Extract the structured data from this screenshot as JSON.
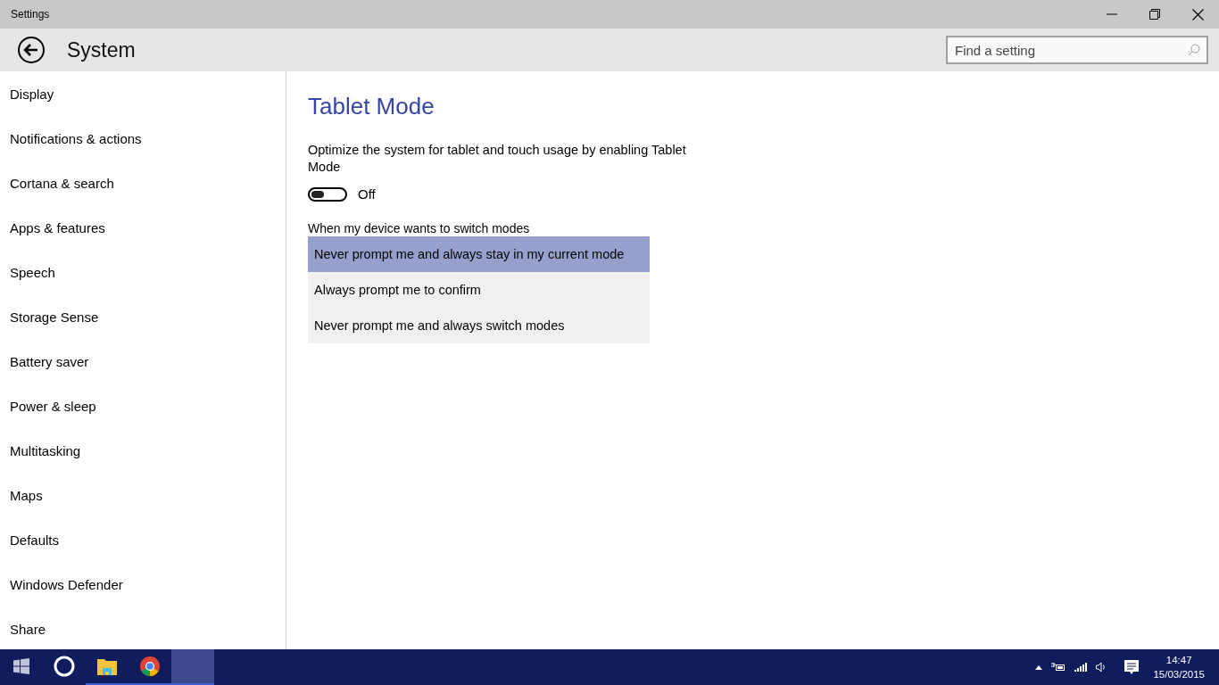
{
  "window": {
    "title": "Settings"
  },
  "header": {
    "title": "System",
    "search": {
      "placeholder": "Find a setting"
    }
  },
  "sidebar": {
    "items": [
      {
        "label": "Display",
        "selected": false
      },
      {
        "label": "Notifications & actions",
        "selected": false
      },
      {
        "label": "Cortana & search",
        "selected": false
      },
      {
        "label": "Apps & features",
        "selected": false
      },
      {
        "label": "Speech",
        "selected": false
      },
      {
        "label": "Storage Sense",
        "selected": false
      },
      {
        "label": "Battery saver",
        "selected": false
      },
      {
        "label": "Power & sleep",
        "selected": false
      },
      {
        "label": "Multitasking",
        "selected": false
      },
      {
        "label": "Maps",
        "selected": false
      },
      {
        "label": "Defaults",
        "selected": false
      },
      {
        "label": "Windows Defender",
        "selected": false
      },
      {
        "label": "Share",
        "selected": false
      }
    ]
  },
  "content": {
    "title": "Tablet Mode",
    "description": "Optimize the system for tablet and touch usage by enabling Tablet Mode",
    "toggle": {
      "on": false,
      "label": "Off"
    },
    "mode_list": {
      "label": "When my device wants to switch modes",
      "options": [
        {
          "label": "Never prompt me and always stay in my current mode",
          "selected": true
        },
        {
          "label": "Always prompt me to confirm",
          "selected": false
        },
        {
          "label": "Never prompt me and always switch modes",
          "selected": false
        }
      ]
    }
  },
  "taskbar": {
    "apps": [
      {
        "kind": "start",
        "running": false,
        "active": false
      },
      {
        "kind": "search",
        "running": false,
        "active": false
      },
      {
        "kind": "folder",
        "running": true,
        "active": false
      },
      {
        "kind": "browser",
        "running": true,
        "active": false
      },
      {
        "kind": "window",
        "running": true,
        "active": true
      }
    ],
    "clock": {
      "time": "14:47",
      "date": "15/03/2015"
    }
  }
}
